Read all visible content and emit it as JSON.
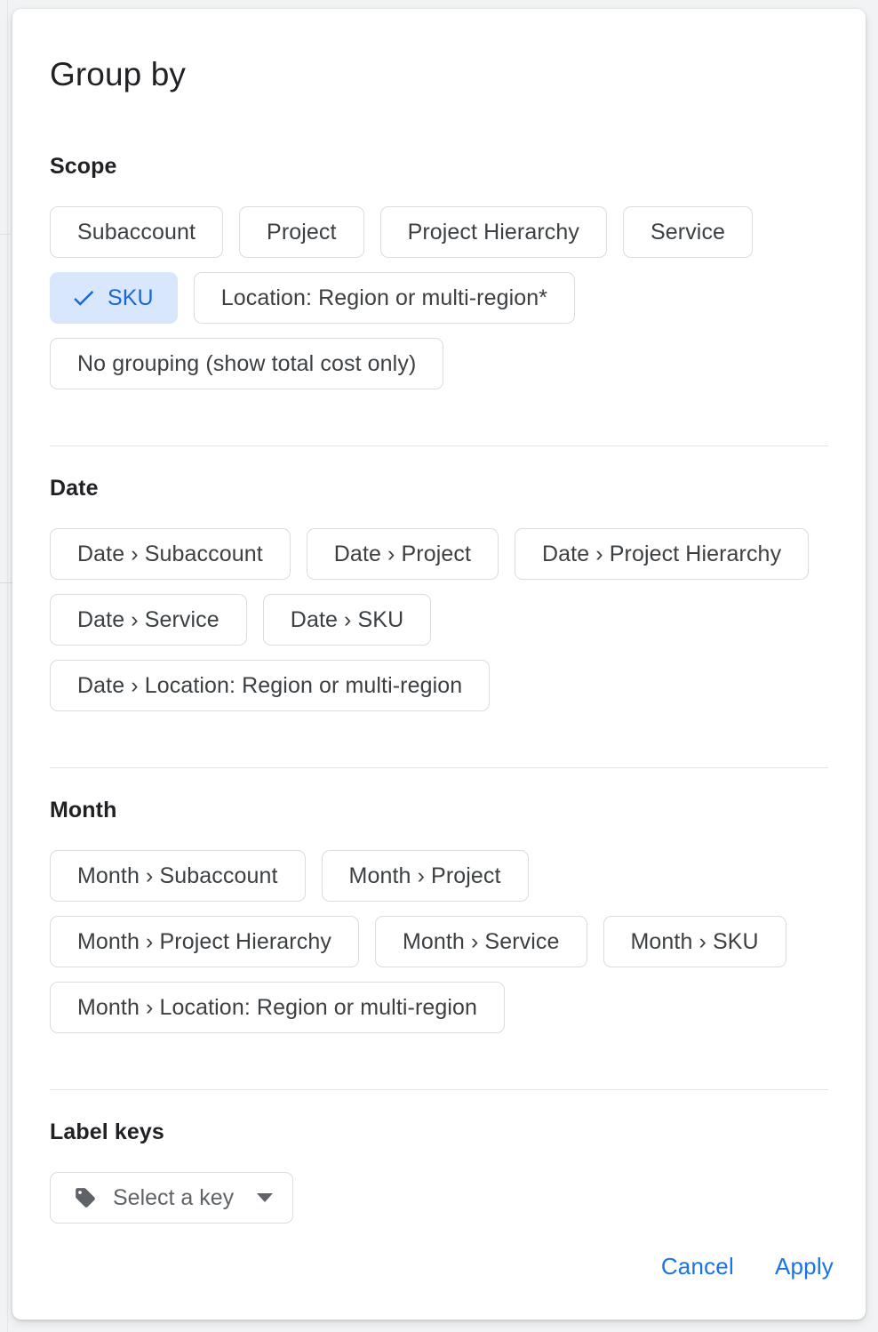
{
  "dialog": {
    "title": "Group by"
  },
  "sections": {
    "scope": {
      "header": "Scope",
      "chips": [
        {
          "label": "Subaccount",
          "selected": false
        },
        {
          "label": "Project",
          "selected": false
        },
        {
          "label": "Project Hierarchy",
          "selected": false
        },
        {
          "label": "Service",
          "selected": false
        },
        {
          "label": "SKU",
          "selected": true
        },
        {
          "label": "Location: Region or multi-region*",
          "selected": false
        },
        {
          "label": "No grouping (show total cost only)",
          "selected": false
        }
      ]
    },
    "date": {
      "header": "Date",
      "chips": [
        {
          "label": "Date › Subaccount",
          "selected": false
        },
        {
          "label": "Date › Project",
          "selected": false
        },
        {
          "label": "Date › Project Hierarchy",
          "selected": false
        },
        {
          "label": "Date › Service",
          "selected": false
        },
        {
          "label": "Date › SKU",
          "selected": false
        },
        {
          "label": "Date › Location: Region or multi-region",
          "selected": false
        }
      ]
    },
    "month": {
      "header": "Month",
      "chips": [
        {
          "label": "Month › Subaccount",
          "selected": false
        },
        {
          "label": "Month › Project",
          "selected": false
        },
        {
          "label": "Month › Project Hierarchy",
          "selected": false
        },
        {
          "label": "Month › Service",
          "selected": false
        },
        {
          "label": "Month › SKU",
          "selected": false
        },
        {
          "label": "Month › Location: Region or multi-region",
          "selected": false
        }
      ]
    },
    "label_keys": {
      "header": "Label keys",
      "select": {
        "value": "Select a key",
        "icon": "tag-icon",
        "caret_icon": "chevron-down-icon"
      }
    }
  },
  "footer": {
    "cancel_label": "Cancel",
    "apply_label": "Apply"
  },
  "colors": {
    "accent": "#1a73e8",
    "selected_chip_bg": "#d9e7fd",
    "selected_chip_text": "#1967d2",
    "chip_border": "#dadce0",
    "chip_text": "#3c4043",
    "title_text": "#202124",
    "divider": "#e3e4e6",
    "backdrop": "#f1f3f4"
  }
}
